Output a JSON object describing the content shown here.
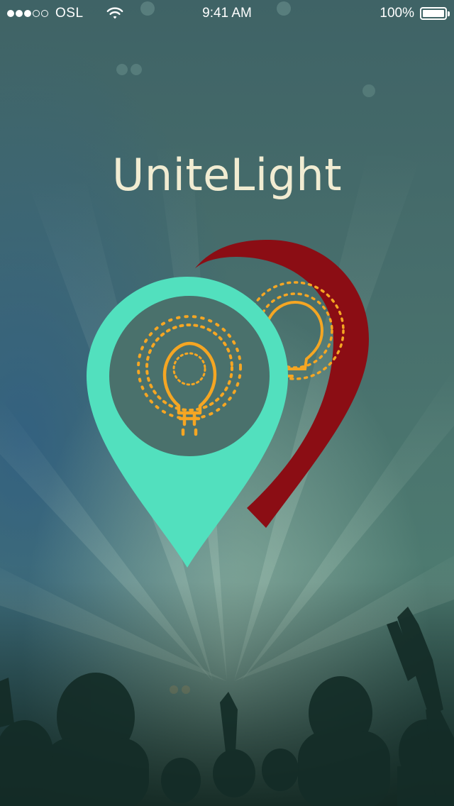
{
  "status_bar": {
    "carrier": "OSL",
    "time": "9:41 AM",
    "battery": "100%",
    "signal_dots_filled": 3,
    "signal_dots_total": 5
  },
  "app": {
    "title": "UniteLight"
  },
  "logo": {
    "front_pin_icon": "teal-map-pin-with-lightbulb",
    "back_pin_icon": "red-map-pin-with-lightbulb",
    "colors": {
      "front_pin": "#52e0be",
      "back_pin": "#8b0d14",
      "bulb": "#f5a623",
      "title": "#f1ecd2"
    }
  }
}
